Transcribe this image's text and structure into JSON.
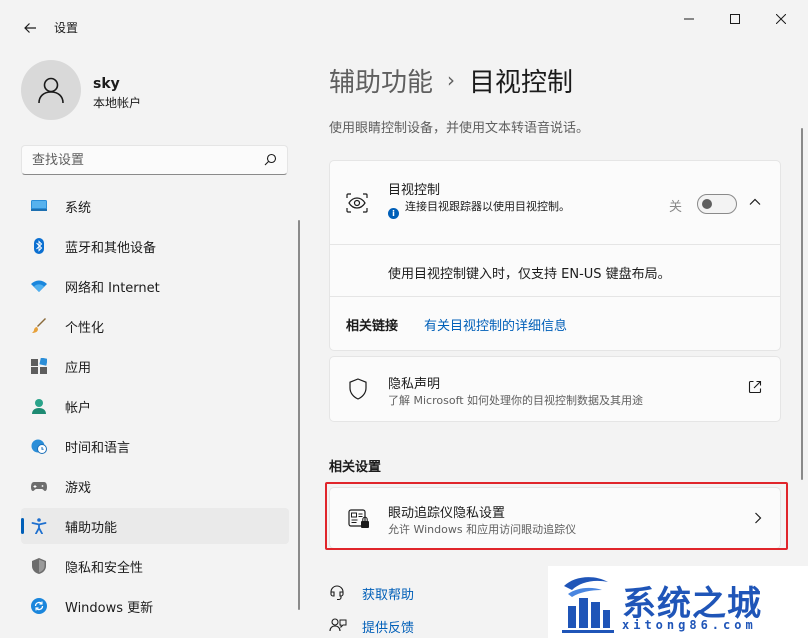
{
  "titlebar": {
    "app_title": "设置"
  },
  "profile": {
    "name": "sky",
    "account_type": "本地帐户"
  },
  "search": {
    "placeholder": "查找设置"
  },
  "nav": {
    "items": [
      {
        "label": "系统",
        "icon": "system-icon"
      },
      {
        "label": "蓝牙和其他设备",
        "icon": "bluetooth-icon"
      },
      {
        "label": "网络和 Internet",
        "icon": "wifi-icon"
      },
      {
        "label": "个性化",
        "icon": "brush-icon"
      },
      {
        "label": "应用",
        "icon": "apps-icon"
      },
      {
        "label": "帐户",
        "icon": "account-icon"
      },
      {
        "label": "时间和语言",
        "icon": "globe-clock-icon"
      },
      {
        "label": "游戏",
        "icon": "gamepad-icon"
      },
      {
        "label": "辅助功能",
        "icon": "accessibility-icon",
        "active": true
      },
      {
        "label": "隐私和安全性",
        "icon": "shield-icon"
      },
      {
        "label": "Windows 更新",
        "icon": "update-icon"
      }
    ]
  },
  "main": {
    "breadcrumb_parent": "辅助功能",
    "breadcrumb_separator": "›",
    "breadcrumb_current": "目视控制",
    "description": "使用眼睛控制设备，并使用文本转语音说话。",
    "eye_control": {
      "title": "目视控制",
      "subtitle": "连接目视跟踪器以使用目视控制。",
      "toggle_label": "关",
      "toggle_on": false,
      "keyboard_note": "使用目视控制键入时，仅支持 EN-US 键盘布局。",
      "related_links_label": "相关链接",
      "related_link": "有关目视控制的详细信息"
    },
    "privacy": {
      "title": "隐私声明",
      "subtitle": "了解 Microsoft 如何处理你的目视控制数据及其用途"
    },
    "related_settings_heading": "相关设置",
    "eye_tracker_privacy": {
      "title": "眼动追踪仪隐私设置",
      "subtitle": "允许 Windows 和应用访问眼动追踪仪"
    },
    "get_help": "获取帮助",
    "give_feedback": "提供反馈"
  },
  "watermark": {
    "text": "系统之城",
    "url": "xitong86.com"
  },
  "colors": {
    "accent": "#005fb8",
    "highlight": "#e0252b",
    "watermark": "#1f55b8"
  }
}
